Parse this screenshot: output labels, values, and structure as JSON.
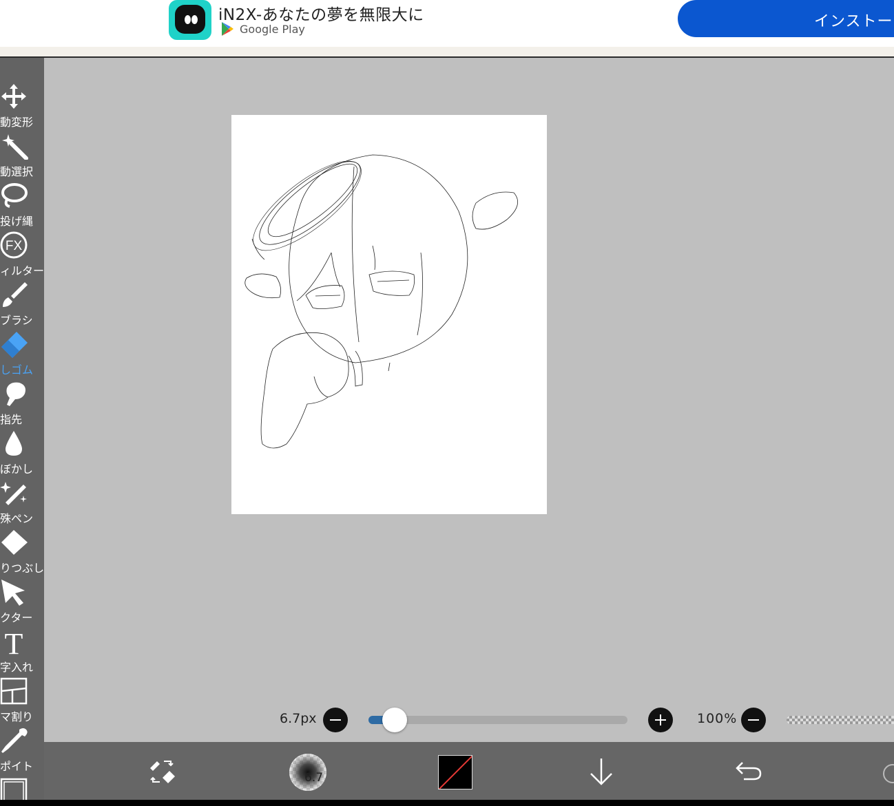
{
  "ad": {
    "title": "iN2X-あなたの夢を無限大に",
    "store": "Google Play",
    "install_label": "インストー"
  },
  "toolbar": {
    "items": [
      {
        "label": "動変形",
        "icon": "move-transform-icon"
      },
      {
        "label": "動選択",
        "icon": "magic-wand-icon"
      },
      {
        "label": "投げ縄",
        "icon": "lasso-icon"
      },
      {
        "label": "ィルター",
        "icon": "fx-filter-icon"
      },
      {
        "label": "ブラシ",
        "icon": "brush-icon"
      },
      {
        "label": "しゴム",
        "icon": "eraser-icon",
        "active": true
      },
      {
        "label": "指先",
        "icon": "finger-smudge-icon"
      },
      {
        "label": "ぼかし",
        "icon": "blur-drop-icon"
      },
      {
        "label": "殊ペン",
        "icon": "special-pen-icon"
      },
      {
        "label": "りつぶし",
        "icon": "fill-bucket-icon"
      },
      {
        "label": "クター",
        "icon": "vector-cursor-icon"
      },
      {
        "label": "字入れ",
        "icon": "text-tool-icon"
      },
      {
        "label": "マ割り",
        "icon": "frame-divider-icon"
      },
      {
        "label": "ポイト",
        "icon": "eyedropper-icon"
      }
    ]
  },
  "brush": {
    "size_label": "6.7px",
    "size_fraction": 0.1,
    "opacity_label": "100%",
    "preview_number": "6.7"
  },
  "colors": {
    "accent": "#2e6ba4",
    "active_tool": "#4aa3f5",
    "toolbar_bg": "#636363",
    "canvas_bg": "#bfbfbf",
    "current_color": "#000000"
  },
  "bottom_bar": {
    "icons": [
      "swap-brush-eraser-icon",
      "brush-preview",
      "color-swatch",
      "layer-down-arrow-icon",
      "undo-icon"
    ]
  }
}
